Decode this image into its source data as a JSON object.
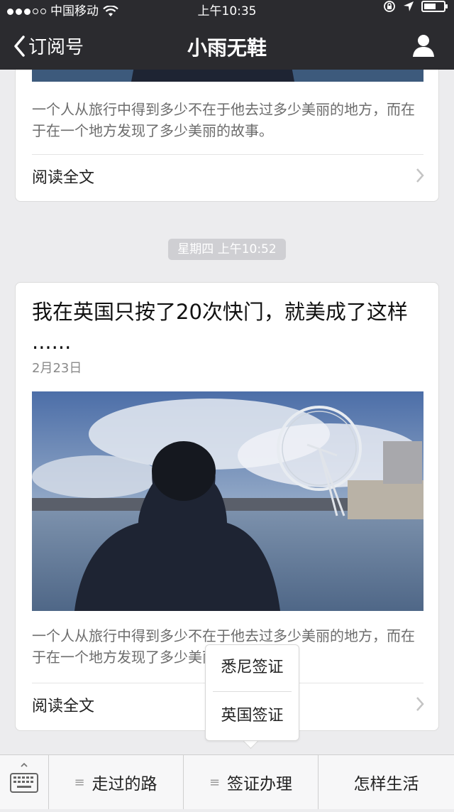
{
  "status_bar": {
    "carrier": "中国移动",
    "time": "上午10:35"
  },
  "nav": {
    "back_label": "订阅号",
    "title": "小雨无鞋"
  },
  "feed": {
    "card1": {
      "summary": "一个人从旅行中得到多少不在于他去过多少美丽的地方，而在于在一个地方发现了多少美丽的故事。",
      "read_more": "阅读全文"
    },
    "timestamp": "星期四 上午10:52",
    "card2": {
      "title": "我在英国只按了20次快门，就美成了这样 ......",
      "date": "2月23日",
      "summary": "一个人从旅行中得到多少不在于他去过多少美丽的地方，而在于在一个地方发现了多少美丽的故事。",
      "read_more": "阅读全文"
    }
  },
  "popup_menu": {
    "items": [
      "悉尼签证",
      "英国签证"
    ]
  },
  "bottom_menu": {
    "items": [
      "走过的路",
      "签证办理",
      "怎样生活"
    ]
  },
  "colors": {
    "nav_bg": "#2b2b2f",
    "page_bg": "#ececee",
    "timestamp_bg": "#cfcfd3"
  }
}
